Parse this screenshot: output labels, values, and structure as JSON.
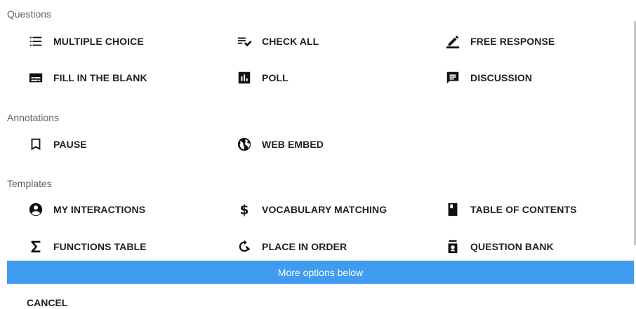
{
  "sections": {
    "questions": "Questions",
    "annotations": "Annotations",
    "templates": "Templates"
  },
  "questions": {
    "multiple_choice": "MULTIPLE CHOICE",
    "check_all": "CHECK ALL",
    "free_response": "FREE RESPONSE",
    "fill_in_blank": "FILL IN THE BLANK",
    "poll": "POLL",
    "discussion": "DISCUSSION"
  },
  "annotations": {
    "pause": "PAUSE",
    "web_embed": "WEB EMBED"
  },
  "templates": {
    "my_interactions": "MY INTERACTIONS",
    "vocabulary_matching": "VOCABULARY MATCHING",
    "table_of_contents": "TABLE OF CONTENTS",
    "functions_table": "FUNCTIONS TABLE",
    "place_in_order": "PLACE IN ORDER",
    "question_bank": "QUESTION BANK"
  },
  "banner_text": "More options below",
  "cancel_label": "CANCEL",
  "colors": {
    "banner": "#3f9cf0",
    "section_title": "#5f6368"
  },
  "icons": {
    "multiple_choice": "list-icon",
    "check_all": "checklist-icon",
    "free_response": "pencil-icon",
    "fill_in_blank": "subtitles-icon",
    "poll": "poll-icon",
    "discussion": "chat-icon",
    "pause": "bookmark-icon",
    "web_embed": "globe-icon",
    "my_interactions": "account-circle-icon",
    "vocabulary_matching": "dollar-icon",
    "table_of_contents": "book-icon",
    "functions_table": "sigma-icon",
    "place_in_order": "sort-icon",
    "question_bank": "bank-icon"
  }
}
